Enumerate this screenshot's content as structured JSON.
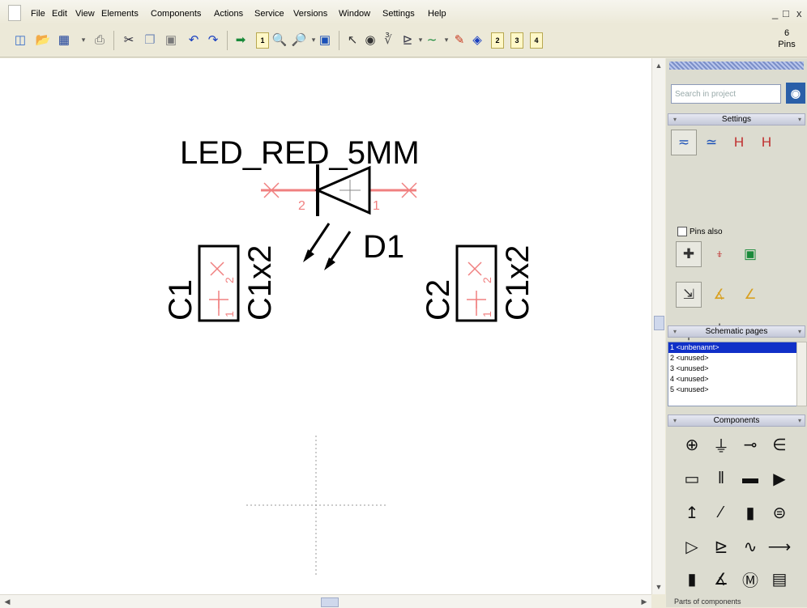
{
  "menu": [
    "File",
    "Edit",
    "View",
    "Elements",
    "Components",
    "Actions",
    "Service",
    "Versions",
    "Window",
    "Settings",
    "Help"
  ],
  "window_controls": [
    "_",
    "□",
    "x"
  ],
  "toolbar": {
    "pages": [
      "1",
      "2",
      "3",
      "4"
    ],
    "pins_count": "6",
    "pins_label": "Pins"
  },
  "schematic": {
    "led_value": "LED_RED_5MM",
    "led_ref": "D1",
    "led_pin1": "1",
    "led_pin2": "2",
    "conn1_ref": "C1",
    "conn1_value": "C1x2",
    "conn2_ref": "C2",
    "conn2_value": "C1x2",
    "conn_pin1": "1",
    "conn_pin2": "2"
  },
  "panel": {
    "search_placeholder": "Search in project",
    "settings_title": "Settings",
    "pins_also": "Pins also",
    "schematic_pages_title": "Schematic pages",
    "pages": [
      "1 <unbenannt>",
      "2 <unused>",
      "3 <unused>",
      "4 <unused>",
      "5 <unused>"
    ],
    "components_title": "Components",
    "bottom_label": "Parts of components"
  },
  "colors": {
    "canvas": "#ffffff",
    "pin_wire": "#f08080",
    "selection": "#1030c8"
  }
}
